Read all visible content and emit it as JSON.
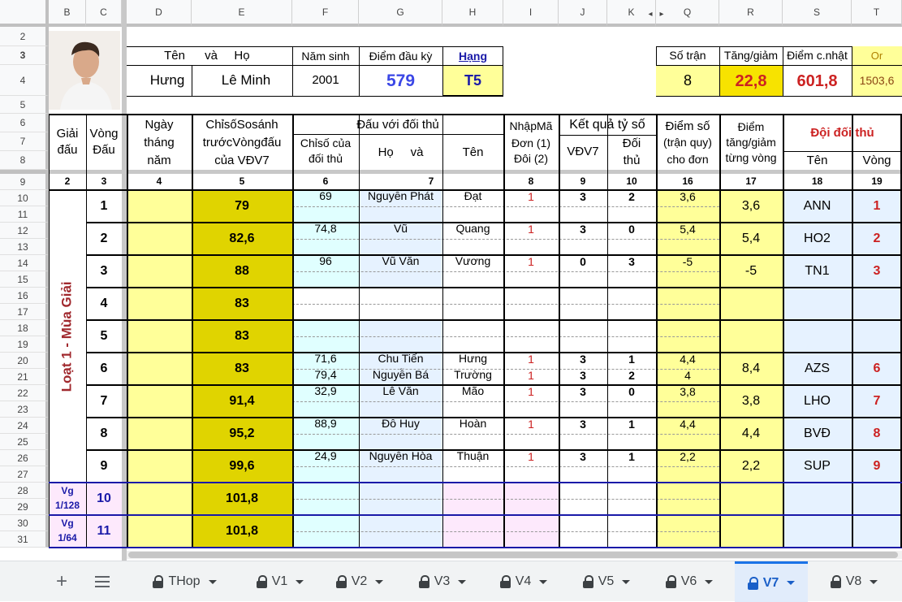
{
  "col_headers": {
    "B": "B",
    "C": "C",
    "D": "D",
    "E": "E",
    "F": "F",
    "G": "G",
    "H": "H",
    "I": "I",
    "J": "J",
    "K": "K",
    "Q": "Q",
    "R": "R",
    "S": "S",
    "T": "T"
  },
  "row_headers": [
    "2",
    "3",
    "4",
    "5",
    "6",
    "7",
    "8",
    "9",
    "10",
    "11",
    "12",
    "13",
    "14",
    "15",
    "16",
    "17",
    "18",
    "19",
    "20",
    "21",
    "22",
    "23",
    "24",
    "25",
    "26",
    "27",
    "28",
    "29",
    "30",
    "31"
  ],
  "profile": {
    "label_ten": "Tên",
    "label_va": "và",
    "label_ho": "Họ",
    "label_nam_sinh": "Năm sinh",
    "label_diem_dau_ky": "Điểm đầu kỳ",
    "label_hang": "Hạng",
    "ten": "Hưng",
    "ho": "Lê Minh",
    "nam_sinh": "2001",
    "diem_dau_ky": "579",
    "hang": "T5",
    "label_so_tran": "Số trận",
    "label_tang_giam": "Tăng/giảm",
    "label_diem_cnhat": "Điểm c.nhật",
    "label_or": "Or",
    "so_tran": "8",
    "tang_giam": "22,8",
    "diem_cnhat": "601,8",
    "or": "1503,6"
  },
  "header": {
    "giai_dau": "Giải đấu",
    "vong_dau": "Vòng Đấu",
    "ngay_1": "Ngày",
    "ngay_2": "tháng",
    "ngay_3": "năm",
    "chiso_1": "ChỉsốSosánh",
    "chiso_2": "trướcVòngđấu",
    "chiso_3": "của VĐV7",
    "dau_voi": "Đấu với đối thủ",
    "chiso_dt_1": "Chỉsố của",
    "chiso_dt_2": "đối thủ",
    "ho_va": "Họ     và",
    "ten": "Tên",
    "nhap_ma_1": "NhậpMã",
    "nhap_ma_2": "Đơn (1)",
    "nhap_ma_3": "Đôi (2)",
    "ket_qua": "Kết quả tỷ số",
    "vdv7": "VĐV7",
    "doi_thu_1": "Đối",
    "doi_thu_2": "thủ",
    "diem_so_1": "Điểm số",
    "diem_so_2": "(trận quy)",
    "diem_so_3": "cho đơn",
    "diem_tg_1": "Điểm",
    "diem_tg_2": "tăng/giảm",
    "diem_tg_3": "từng vòng",
    "doi_doi_thu": "Đội đối thủ",
    "ten2": "Tên",
    "vong2": "Vòng"
  },
  "col_numbers": [
    "2",
    "3",
    "4",
    "5",
    "6",
    "7",
    "8",
    "9",
    "10",
    "16",
    "17",
    "18",
    "19"
  ],
  "season_label": "Loạt 1 - Mùa Giải",
  "rounds": [
    {
      "vong": "1",
      "chiso": "79",
      "opp": [
        {
          "cs": "69",
          "ho": "Nguyễn Phát",
          "ten": "Đạt",
          "ma": "1",
          "a": "3",
          "b": "2",
          "ds": "3,6"
        }
      ],
      "tg": "3,6",
      "team": "ANN",
      "tv": "1"
    },
    {
      "vong": "2",
      "chiso": "82,6",
      "opp": [
        {
          "cs": "74,8",
          "ho": "Vũ",
          "ten": "Quang",
          "ma": "1",
          "a": "3",
          "b": "0",
          "ds": "5,4"
        }
      ],
      "tg": "5,4",
      "team": "HO2",
      "tv": "2"
    },
    {
      "vong": "3",
      "chiso": "88",
      "opp": [
        {
          "cs": "96",
          "ho": "Vũ Văn",
          "ten": "Vương",
          "ma": "1",
          "a": "0",
          "b": "3",
          "ds": "-5"
        }
      ],
      "tg": "-5",
      "team": "TN1",
      "tv": "3"
    },
    {
      "vong": "4",
      "chiso": "83",
      "opp": [],
      "tg": "",
      "team": "",
      "tv": ""
    },
    {
      "vong": "5",
      "chiso": "83",
      "opp": [],
      "tg": "",
      "team": "",
      "tv": ""
    },
    {
      "vong": "6",
      "chiso": "83",
      "opp": [
        {
          "cs": "71,6",
          "ho": "Chu Tiến",
          "ten": "Hưng",
          "ma": "1",
          "a": "3",
          "b": "1",
          "ds": "4,4"
        },
        {
          "cs": "79,4",
          "ho": "Nguyễn Bá",
          "ten": "Trường",
          "ma": "1",
          "a": "3",
          "b": "2",
          "ds": "4"
        }
      ],
      "tg": "8,4",
      "team": "AZS",
      "tv": "6"
    },
    {
      "vong": "7",
      "chiso": "91,4",
      "opp": [
        {
          "cs": "32,9",
          "ho": "Lê Văn",
          "ten": "Mão",
          "ma": "1",
          "a": "3",
          "b": "0",
          "ds": "3,8"
        }
      ],
      "tg": "3,8",
      "team": "LHO",
      "tv": "7"
    },
    {
      "vong": "8",
      "chiso": "95,2",
      "opp": [
        {
          "cs": "88,9",
          "ho": "Đỗ Huy",
          "ten": "Hoàn",
          "ma": "1",
          "a": "3",
          "b": "1",
          "ds": "4,4"
        }
      ],
      "tg": "4,4",
      "team": "BVĐ",
      "tv": "8"
    },
    {
      "vong": "9",
      "chiso": "99,6",
      "opp": [
        {
          "cs": "24,9",
          "ho": "Nguyễn Hòa",
          "ten": "Thuận",
          "ma": "1",
          "a": "3",
          "b": "1",
          "ds": "2,2"
        }
      ],
      "tg": "2,2",
      "team": "SUP",
      "tv": "9"
    },
    {
      "vong": "10",
      "chiso": "101,8",
      "opp": [],
      "tg": "",
      "team": "",
      "tv": "",
      "giai_1": "Vg",
      "giai_2": "1/128"
    },
    {
      "vong": "11",
      "chiso": "101,8",
      "opp": [],
      "tg": "",
      "team": "",
      "tv": "",
      "giai_1": "Vg",
      "giai_2": "1/64"
    }
  ],
  "tabs": {
    "add": "+",
    "items": [
      {
        "label": "THop",
        "active": false
      },
      {
        "label": "V1",
        "active": false
      },
      {
        "label": "V2",
        "active": false
      },
      {
        "label": "V3",
        "active": false
      },
      {
        "label": "V4",
        "active": false
      },
      {
        "label": "V5",
        "active": false
      },
      {
        "label": "V6",
        "active": false
      },
      {
        "label": "V7",
        "active": true
      },
      {
        "label": "V8",
        "active": false
      }
    ]
  },
  "colors": {
    "yellow": "#ffff99",
    "olive": "#e0d400",
    "cyan": "#e0ffff",
    "lightblue": "#e6f2ff",
    "pink": "#fde9fc",
    "blue_text": "#3b47e6",
    "red_text": "#cc2222",
    "maroon": "#a0282d",
    "navy": "#1a1aa8"
  }
}
